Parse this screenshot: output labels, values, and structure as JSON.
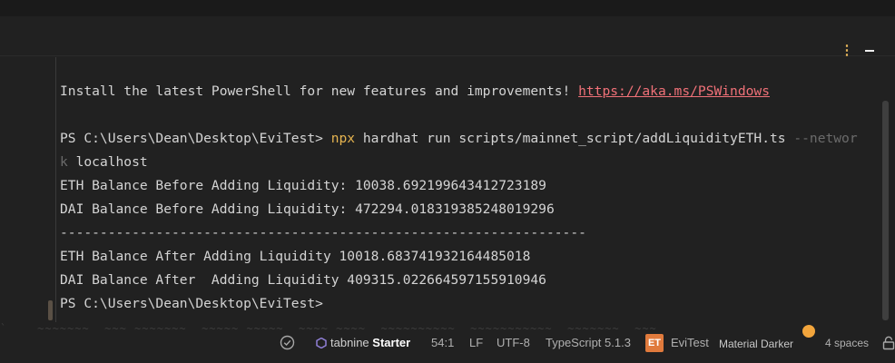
{
  "terminal": {
    "install_text": "Install the latest PowerShell for new features and improvements! ",
    "install_link": "https://aka.ms/PSWindows",
    "prompt1": "PS C:\\Users\\Dean\\Desktop\\EviTest> ",
    "cmd_npx": "npx",
    "cmd_rest": " hardhat run scripts/mainnet_script/addLiquidityETH.ts ",
    "cmd_flag_a": "--networ",
    "cmd_flag_b": "k",
    "cmd_arg": " localhost",
    "eth_before": "ETH Balance Before Adding Liquidity: 10038.692199643412723189",
    "dai_before": "DAI Balance Before Adding Liquidity: 472294.018319385248019296",
    "separator": "------------------------------------------------------------------",
    "eth_after": "ETH Balance After Adding Liquidity 10018.683741932164485018",
    "dai_after": "DAI Balance After  Adding Liquidity 409315.022664597155910946",
    "prompt2": "PS C:\\Users\\Dean\\Desktop\\EviTest>"
  },
  "statusbar": {
    "tabnine_brand": "tabnine",
    "tabnine_tier": "Starter",
    "position": "54:1",
    "line_ending": "LF",
    "encoding": "UTF-8",
    "language": "TypeScript 5.1.3",
    "project_badge": "ET",
    "project": "EviTest",
    "theme": "Material Darker",
    "indent": "4 spaces"
  },
  "colors": {
    "background": "#212121",
    "text": "#d4d4d4",
    "link": "#f07178",
    "npx": "#e6b450",
    "accent": "#e07a3c"
  },
  "icons": [
    "kebab-menu-icon",
    "minimize-icon",
    "check-circle-icon",
    "tabnine-icon",
    "notification-dot-icon",
    "lock-icon"
  ]
}
